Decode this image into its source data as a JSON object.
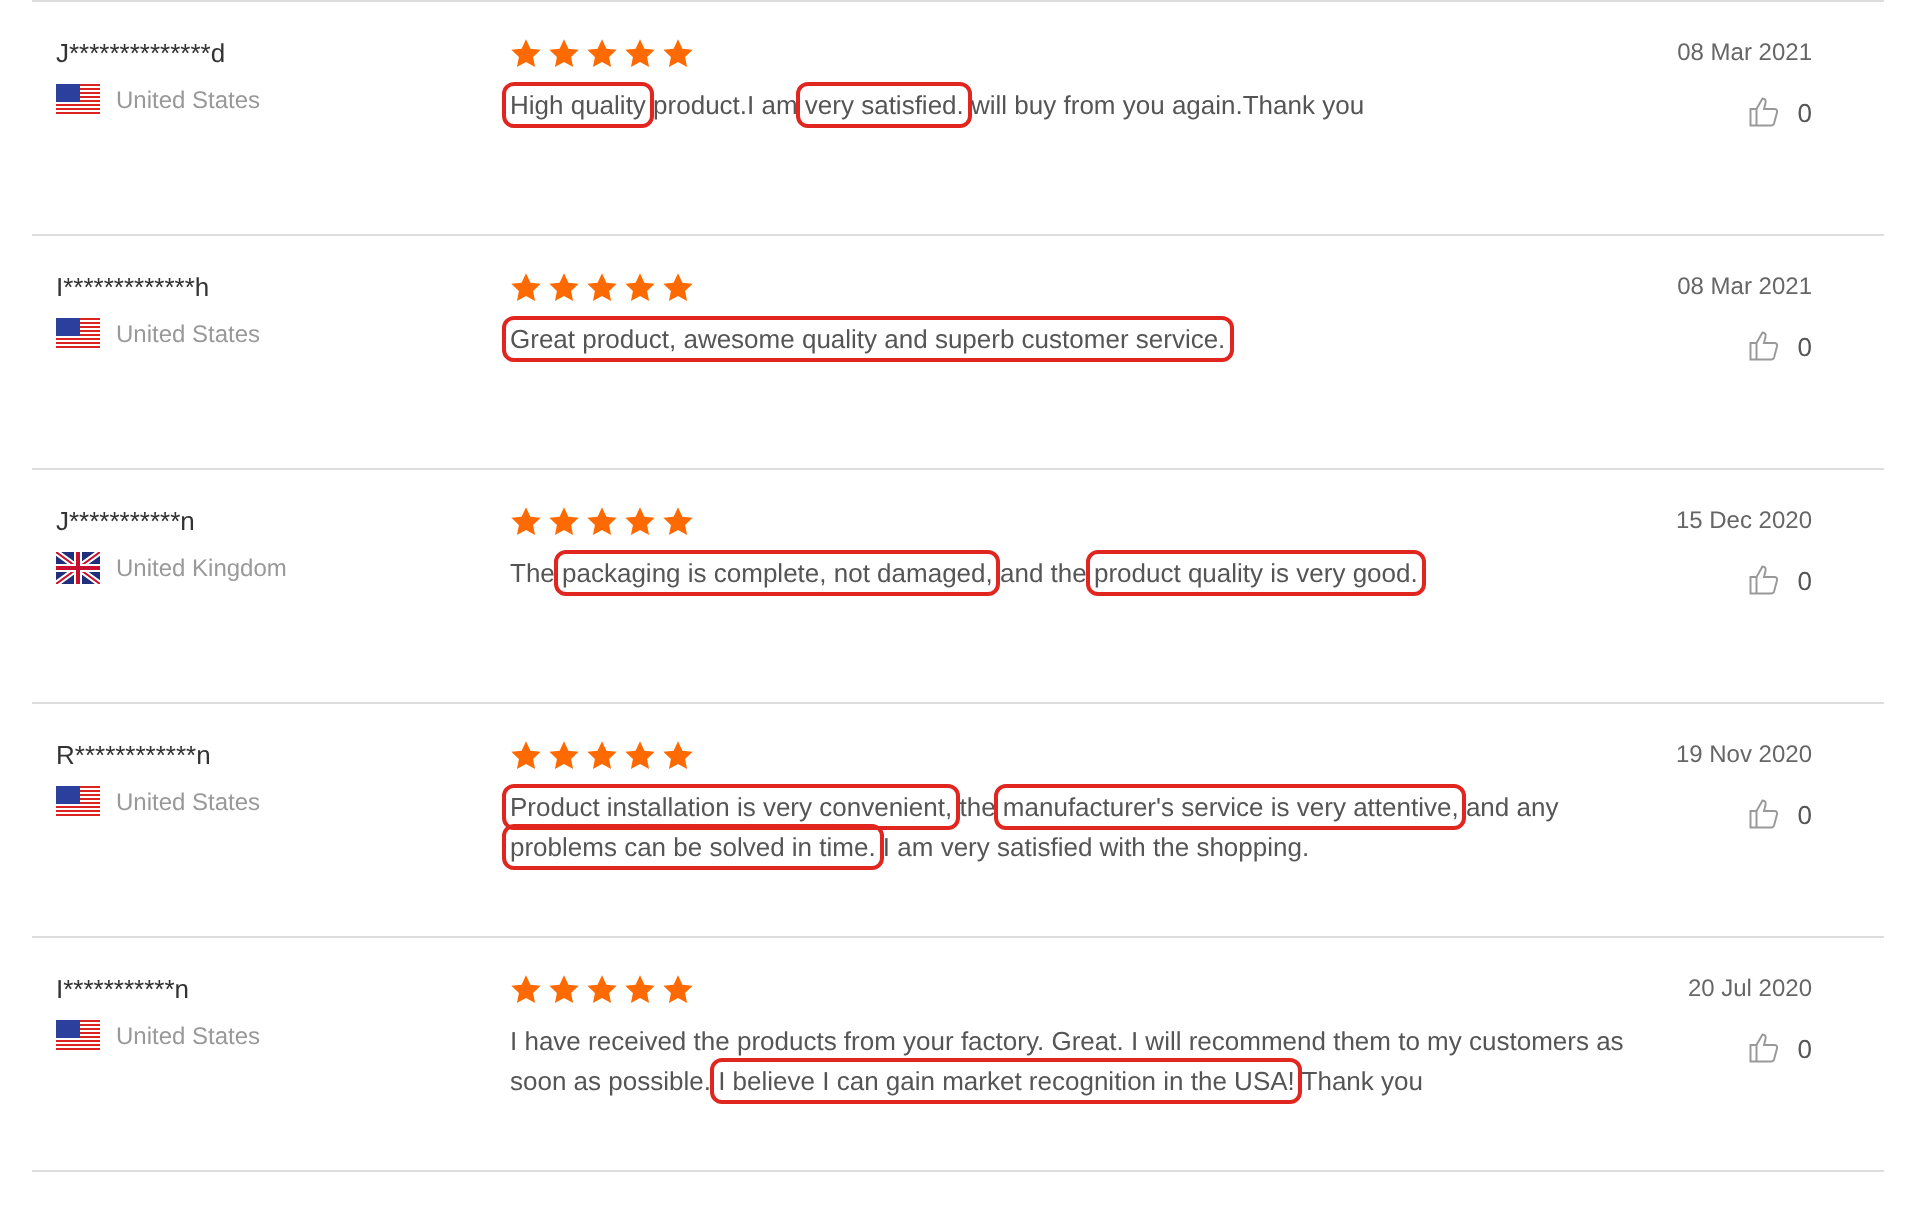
{
  "reviews": [
    {
      "name": "J**************d",
      "country": "United States",
      "flag": {
        "kind": "us"
      },
      "stars": 5,
      "date": "08 Mar 2021",
      "likes": "0",
      "text": [
        {
          "t": "High quality",
          "highlighted": true
        },
        {
          "t": " product.I am ",
          "highlighted": false
        },
        {
          "t": "very satisfied.",
          "highlighted": true
        },
        {
          "t": " will buy from you again.Thank you",
          "highlighted": false
        }
      ]
    },
    {
      "name": "I*************h",
      "country": "United States",
      "flag": {
        "kind": "us"
      },
      "stars": 5,
      "date": "08 Mar 2021",
      "likes": "0",
      "text": [
        {
          "t": "Great product, awesome quality and superb customer service.",
          "highlighted": true
        }
      ]
    },
    {
      "name": "J***********n",
      "country": "United Kingdom",
      "flag": {
        "kind": "uk"
      },
      "stars": 5,
      "date": "15 Dec 2020",
      "likes": "0",
      "text": [
        {
          "t": "The ",
          "highlighted": false
        },
        {
          "t": "packaging is complete, not damaged,",
          "highlighted": true
        },
        {
          "t": " and the ",
          "highlighted": false
        },
        {
          "t": "product quality is very good.",
          "highlighted": true
        }
      ]
    },
    {
      "name": "R************n",
      "country": "United States",
      "flag": {
        "kind": "us"
      },
      "stars": 5,
      "date": "19 Nov 2020",
      "likes": "0",
      "text": [
        {
          "t": "Product installation is very convenient,",
          "highlighted": true
        },
        {
          "t": " the ",
          "highlighted": false
        },
        {
          "t": "manufacturer's service is very attentive,",
          "highlighted": true
        },
        {
          "t": " and any ",
          "highlighted": false
        },
        {
          "t": "problems can be solved in time.",
          "highlighted": true
        },
        {
          "t": " I am very satisfied with the shopping.",
          "highlighted": false
        }
      ]
    },
    {
      "name": "I***********n",
      "country": "United States",
      "flag": {
        "kind": "us"
      },
      "stars": 5,
      "date": "20 Jul 2020",
      "likes": "0",
      "text": [
        {
          "t": "I have received the products from your factory. Great. I will recommend them to my customers as soon as possible. ",
          "highlighted": false
        },
        {
          "t": "I believe I can gain market recognition in the USA!",
          "highlighted": true
        },
        {
          "t": " Thank you",
          "highlighted": false
        }
      ]
    }
  ]
}
